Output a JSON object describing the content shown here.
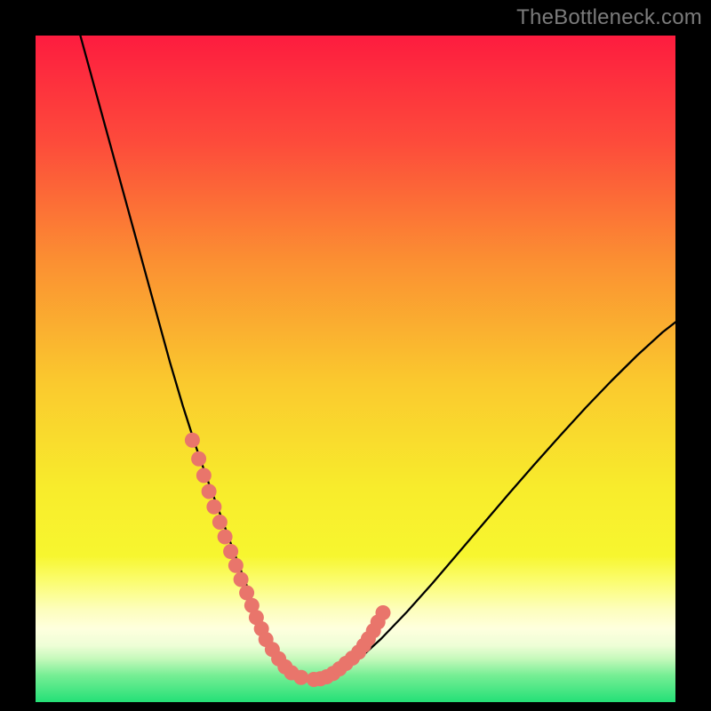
{
  "watermark": "TheBottleneck.com",
  "chart_data": {
    "type": "line",
    "title": "",
    "xlabel": "",
    "ylabel": "",
    "xlim": [
      0,
      100
    ],
    "ylim": [
      0,
      100
    ],
    "grid": false,
    "series": [
      {
        "name": "bottleneck-curve",
        "x": [
          7,
          9,
          11,
          13,
          15,
          17,
          19,
          21,
          23,
          25,
          27,
          29,
          31,
          33,
          34.5,
          36,
          37.5,
          39.5,
          42.5,
          46,
          50,
          54,
          58,
          62,
          66,
          70,
          74,
          78,
          82,
          86,
          90,
          94,
          98,
          100
        ],
        "y": [
          100,
          93,
          86,
          79,
          72,
          65,
          58,
          51,
          44.5,
          38.5,
          33,
          27.8,
          22.5,
          17.5,
          13.5,
          10,
          7,
          4.8,
          3.4,
          3.8,
          6,
          9.5,
          13.5,
          17.8,
          22.3,
          26.8,
          31.3,
          35.7,
          40,
          44.2,
          48.2,
          52,
          55.5,
          57
        ]
      },
      {
        "name": "highlight-dots",
        "x": [
          24.5,
          25.5,
          26.3,
          27.1,
          27.9,
          28.8,
          29.6,
          30.5,
          31.3,
          32.1,
          33,
          33.8,
          34.5,
          35.3,
          36,
          37,
          38,
          39,
          40,
          41.5,
          43.5,
          44.5,
          45.5,
          46.5,
          47.5,
          48.5,
          49.5,
          50.5,
          51.3,
          52,
          52.8,
          53.5,
          54.3
        ],
        "y": [
          39.3,
          36.5,
          34,
          31.6,
          29.3,
          27,
          24.8,
          22.6,
          20.5,
          18.4,
          16.4,
          14.5,
          12.7,
          11,
          9.4,
          7.9,
          6.5,
          5.3,
          4.4,
          3.7,
          3.4,
          3.5,
          3.8,
          4.3,
          5,
          5.8,
          6.6,
          7.5,
          8.5,
          9.5,
          10.7,
          12,
          13.4
        ]
      }
    ],
    "background_gradient": {
      "top": "#fd1c3f",
      "upper": "#fd6a37",
      "mid": "#fac92e",
      "lower": "#f7f62f",
      "band": "#fafe8f",
      "bottom": "#2fe47e"
    },
    "dot_color": "#e9756b",
    "curve_color": "#000000"
  }
}
